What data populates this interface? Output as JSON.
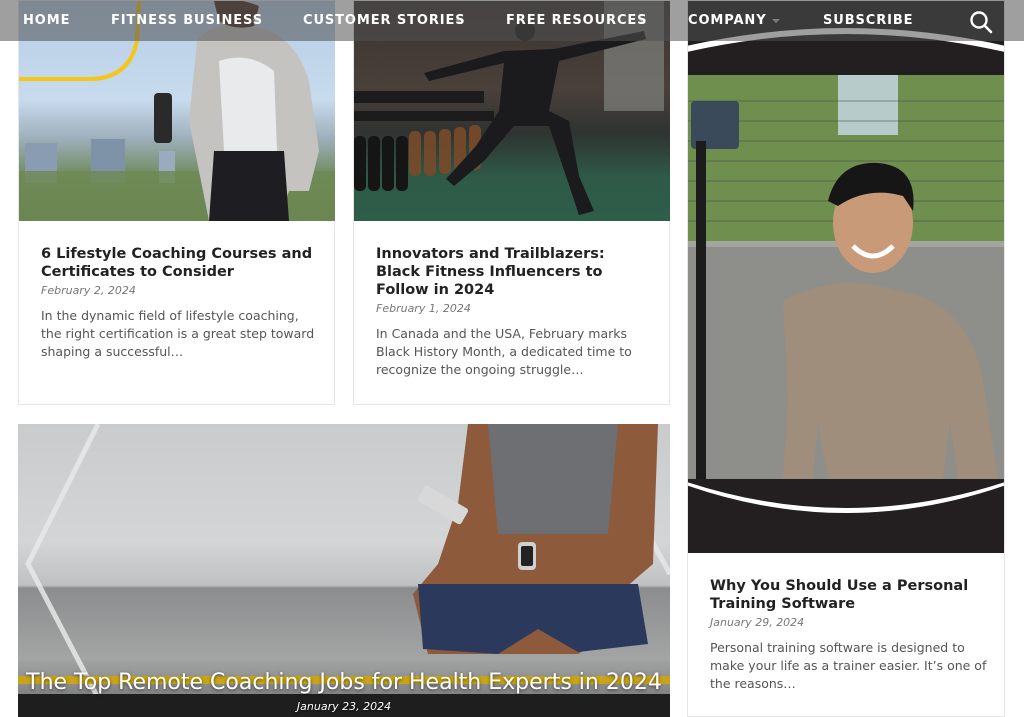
{
  "nav": {
    "items": [
      {
        "label": "Home",
        "has_dropdown": false
      },
      {
        "label": "Fitness Business",
        "has_dropdown": true
      },
      {
        "label": "Customer Stories",
        "has_dropdown": true
      },
      {
        "label": "Free Resources",
        "has_dropdown": true
      },
      {
        "label": "Company",
        "has_dropdown": true
      },
      {
        "label": "Subscribe",
        "has_dropdown": false
      }
    ],
    "search_icon": "search-icon"
  },
  "posts": [
    {
      "title": "6 Lifestyle Coaching Courses and Certificates to Consider",
      "date": "February 2, 2024",
      "excerpt": "In the dynamic field of lifestyle coaching, the right certification is a great step toward shaping a successful…",
      "image": "woman-walking-with-bottle-city-skyline"
    },
    {
      "title": "Innovators and Trailblazers: Black Fitness Influencers to Follow in 2024",
      "date": "February 1, 2024",
      "excerpt": "In Canada and the USA, February marks Black History Month, a dedicated time to recognize the ongoing struggle…",
      "image": "man-stretching-in-gym"
    },
    {
      "title": "Why You Should Use a Personal Training Software",
      "date": "January 29, 2024",
      "excerpt": "Personal training software is designed to make your life as a trainer easier. It’s one of the reasons…",
      "image": "smiling-trainer-with-phone-tripod"
    }
  ],
  "feature": {
    "title": "The Top Remote Coaching Jobs for Health Experts in 2024",
    "date": "January 23, 2024",
    "image": "woman-sitting-with-phone-and-earphones"
  },
  "colors": {
    "accent_yellow": "#f5c518",
    "nav_overlay": "#505050",
    "title_text": "#222222",
    "body_text": "#555555"
  }
}
